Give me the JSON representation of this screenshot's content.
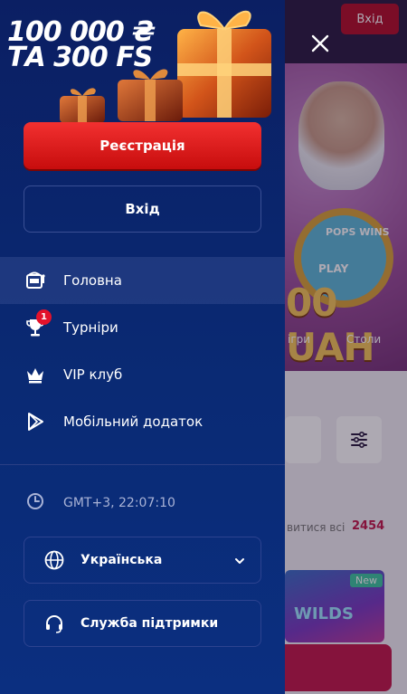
{
  "background": {
    "login_label": "Вхід",
    "hero_sub": "POPS WINS",
    "hero_provider": "PLAY",
    "hero_amount": "00 UAH",
    "hero_tab_games": "ігри",
    "hero_tab_tables": "Столи",
    "show_all": "витися всі",
    "games_count": "2454",
    "game_badge": "New",
    "game_name": "WILDS"
  },
  "drawer": {
    "promo": {
      "line1": "100 000 ₴",
      "line2": "ТА 300 FS"
    },
    "register_label": "Реєстрація",
    "login_label": "Вхід",
    "nav": [
      {
        "label": "Головна",
        "icon": "slot-machine-icon",
        "active": true
      },
      {
        "label": "Турніри",
        "icon": "trophy-icon",
        "badge": "1"
      },
      {
        "label": "VIP клуб",
        "icon": "crown-icon"
      },
      {
        "label": "Мобільний додаток",
        "icon": "play-store-icon"
      }
    ],
    "time": "GMT+3, 22:07:10",
    "language": "Українська",
    "support": "Служба підтримки"
  },
  "colors": {
    "drawer_bg": "#0b1f63",
    "accent_red": "#e3122b",
    "muted_text": "#a9b3d6"
  }
}
